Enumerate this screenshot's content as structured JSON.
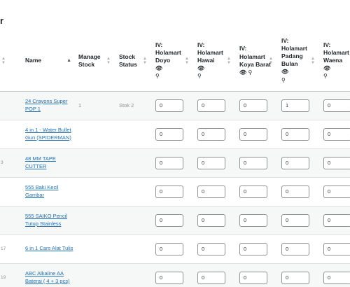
{
  "page": {
    "title_fragment": "r"
  },
  "columns": {
    "name": "Name",
    "manage_stock": "Manage Stock",
    "stock_status": "Stock Status",
    "iv_prefix": "IV:",
    "locations": [
      "Holamart Doyo",
      "Holamart Hawai",
      "Holamart Koya Barat",
      "Holamart Padang Bulan",
      "Holamart Waena"
    ]
  },
  "icons": {
    "visible": "eye-icon",
    "link": "link-icon"
  },
  "rows": [
    {
      "id": "",
      "name": "24 Crayons Super POP 1",
      "manage_stock": "1",
      "stock_status": "Stok 2",
      "qty": [
        "0",
        "0",
        "0",
        "1",
        "0"
      ]
    },
    {
      "id": "",
      "name": "4 in 1 - Water Bullet Gun (SPIDERMAN)",
      "manage_stock": "",
      "stock_status": "",
      "qty": [
        "0",
        "0",
        "0",
        "0",
        "0"
      ]
    },
    {
      "id": "3",
      "name": "48 MM TAPE CUTTER",
      "manage_stock": "",
      "stock_status": "",
      "qty": [
        "0",
        "0",
        "0",
        "0",
        "0"
      ]
    },
    {
      "id": "",
      "name": "555 Baki Kecil Gambar",
      "manage_stock": "",
      "stock_status": "",
      "qty": [
        "0",
        "0",
        "0",
        "0",
        "0"
      ]
    },
    {
      "id": "",
      "name": "555 SAIKO Pencil Tutup Stainless",
      "manage_stock": "",
      "stock_status": "",
      "qty": [
        "0",
        "0",
        "0",
        "0",
        "0"
      ]
    },
    {
      "id": "17",
      "name": "6 in 1 Cars Alat Tulis",
      "manage_stock": "",
      "stock_status": "",
      "qty": [
        "0",
        "0",
        "0",
        "0",
        "0"
      ]
    },
    {
      "id": "19",
      "name": "ABC Alkaline AA Baterai ( 4 + 3 pcs)",
      "manage_stock": "",
      "stock_status": "",
      "qty": [
        "0",
        "0",
        "0",
        "0",
        "0"
      ]
    }
  ]
}
